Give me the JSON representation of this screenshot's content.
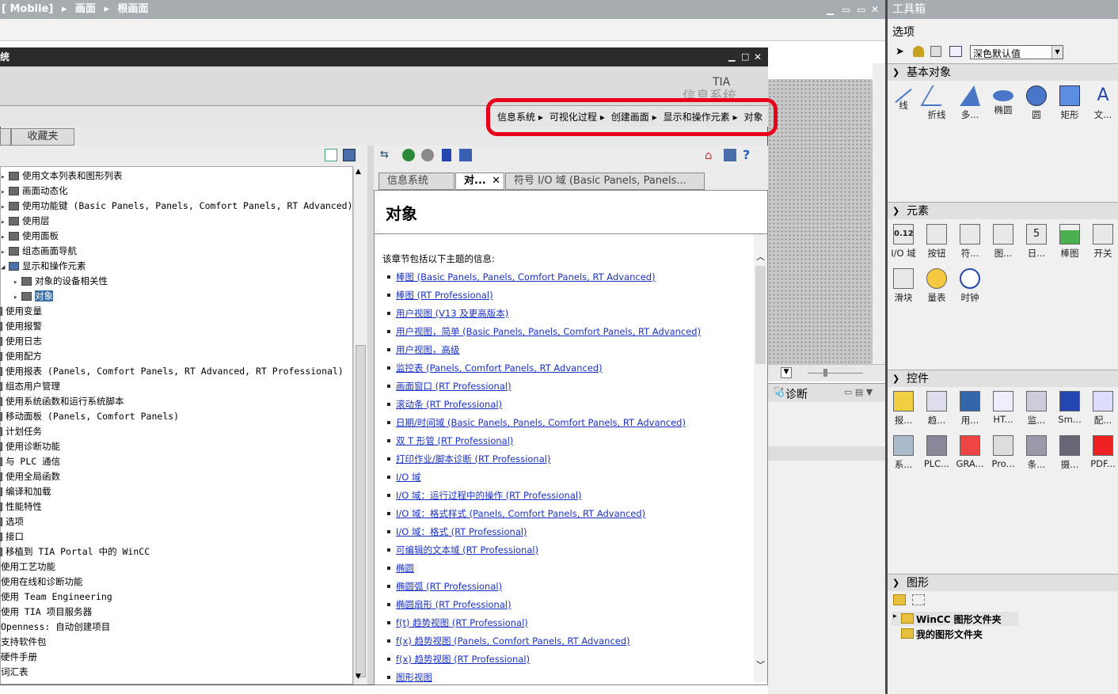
{
  "topbar": {
    "path_part1": "[ Mobile]",
    "sep": "▸",
    "path_part2": "画面",
    "path_part3": "根画面",
    "min": "▁",
    "restore": "▭",
    "close": "✕",
    "extra": "▭"
  },
  "toolbox": {
    "title": "工具箱",
    "options_label": "选项",
    "style_select": "深色默认值",
    "basic_title": "基本对象",
    "basic": [
      "线",
      "折线",
      "多...",
      "椭圆",
      "圆",
      "矩形",
      "文..."
    ],
    "elements_title": "元素",
    "elements": [
      "I/O 域",
      "按钮",
      "符...",
      "图...",
      "日...",
      "棒图",
      "开关",
      "滑块",
      "量表",
      "时钟"
    ],
    "controls_title": "控件",
    "controls": [
      "报...",
      "趋...",
      "用...",
      "HT...",
      "监...",
      "Sm...",
      "配...",
      "系...",
      "PLC...",
      "GRA...",
      "Pro...",
      "条...",
      "摄...",
      "PDF..."
    ],
    "graphics_title": "图形",
    "graphics": [
      "WinCC 图形文件夹",
      "我的图形文件夹"
    ],
    "io_icon_text": "0.12",
    "date_icon_text": "5"
  },
  "help": {
    "title_fragment": "统",
    "tia": "TIA",
    "tia_sub": "信息系统",
    "breadcrumbs": [
      "信息系统",
      "可视化过程",
      "创建画面",
      "显示和操作元素",
      "对象"
    ],
    "left_tab": "收藏夹",
    "tree": [
      {
        "t": "使用文本列表和图形列表",
        "lvl": 1
      },
      {
        "t": "画面动态化",
        "lvl": 1
      },
      {
        "t": "使用功能键 (Basic Panels, Panels, Comfort Panels, RT Advanced)",
        "lvl": 1
      },
      {
        "t": "使用层",
        "lvl": 1
      },
      {
        "t": "使用面板",
        "lvl": 1
      },
      {
        "t": "组态画面导航",
        "lvl": 1
      },
      {
        "t": "显示和操作元素",
        "lvl": 1,
        "open": true
      },
      {
        "t": "对象的设备相关性",
        "lvl": 2
      },
      {
        "t": "对象",
        "lvl": 2,
        "sel": true
      },
      {
        "t": "使用变量",
        "lvl": 0
      },
      {
        "t": "使用报警",
        "lvl": 0
      },
      {
        "t": "使用日志",
        "lvl": 0
      },
      {
        "t": "使用配方",
        "lvl": 0
      },
      {
        "t": "使用报表 (Panels, Comfort Panels, RT Advanced, RT Professional)",
        "lvl": 0
      },
      {
        "t": "组态用户管理",
        "lvl": 0
      },
      {
        "t": "使用系统函数和运行系统脚本",
        "lvl": 0
      },
      {
        "t": "移动面板 (Panels, Comfort Panels)",
        "lvl": 0
      },
      {
        "t": "计划任务",
        "lvl": 0
      },
      {
        "t": "使用诊断功能",
        "lvl": 0
      },
      {
        "t": "与 PLC 通信",
        "lvl": 0
      },
      {
        "t": "使用全局函数",
        "lvl": 0
      },
      {
        "t": "编译和加载",
        "lvl": 0
      },
      {
        "t": "性能特性",
        "lvl": 0
      },
      {
        "t": "选项",
        "lvl": 0
      },
      {
        "t": "接口",
        "lvl": 0
      },
      {
        "t": "移植到 TIA Portal 中的 WinCC",
        "lvl": 0
      },
      {
        "t": "使用工艺功能",
        "lvl": -1
      },
      {
        "t": "使用在线和诊断功能",
        "lvl": -1
      },
      {
        "t": "使用 Team Engineering",
        "lvl": -1
      },
      {
        "t": "使用 TIA 项目服务器",
        "lvl": -1
      },
      {
        "t": "Openness: 自动创建项目",
        "lvl": -1
      },
      {
        "t": "支持软件包",
        "lvl": -1
      },
      {
        "t": "硬件手册",
        "lvl": -1
      },
      {
        "t": "词汇表",
        "lvl": -1
      }
    ],
    "tabs": [
      "信息系统",
      "对...",
      "符号 I/O 域 (Basic Panels, Panels..."
    ],
    "tab_close": "✕",
    "content_title": "对象",
    "intro": "该章节包括以下主题的信息:",
    "links": [
      "棒图 (Basic Panels, Panels, Comfort Panels, RT Advanced)",
      "棒图 (RT Professional)",
      "用户视图 (V13 及更高版本)",
      "用户视图，简单 (Basic Panels, Panels, Comfort Panels, RT Advanced)",
      "用户视图，高级",
      "监控表 (Panels, Comfort Panels, RT Advanced)",
      "画面窗口 (RT Professional)",
      "滚动条 (RT Professional)",
      "日期/时间域 (Basic Panels, Panels, Comfort Panels, RT Advanced)",
      "双 T 形管 (RT Professional)",
      "打印作业/脚本诊断 (RT Professional)",
      "I/O 域",
      "I/O 域：运行过程中的操作 (RT Professional)",
      "I/O 域：格式样式 (Panels, Comfort Panels, RT Advanced)",
      "I/O 域：格式 (RT Professional)",
      "可编辑的文本域 (RT Professional)",
      "椭圆",
      "椭圆弧 (RT Professional)",
      "椭圆扇形 (RT Professional)",
      "f(t) 趋势视图 (RT Professional)",
      "f(x) 趋势视图 (Panels, Comfort Panels, RT Advanced)",
      "f(x) 趋势视图 (RT Professional)",
      "图形视图"
    ]
  },
  "diagnostics": {
    "label": "诊断"
  },
  "colors": {
    "highlight": "#e8001a",
    "link": "#1a32c8",
    "selection": "#3a6ea5"
  }
}
